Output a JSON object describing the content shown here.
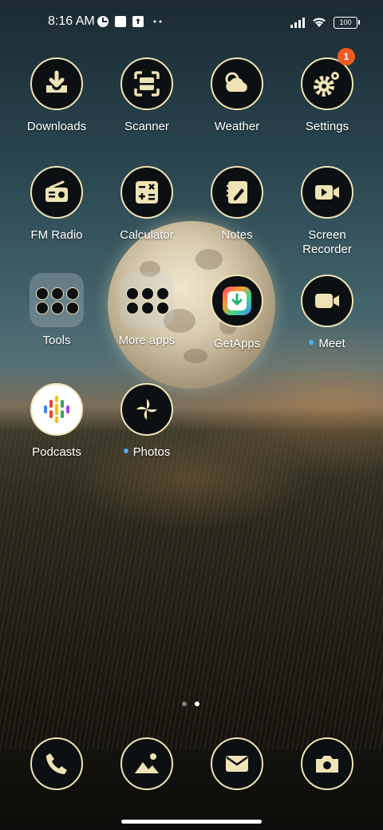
{
  "status_bar": {
    "time": "8:16 AM",
    "battery": "100"
  },
  "apps": {
    "downloads": {
      "label": "Downloads",
      "icon": "download-icon"
    },
    "scanner": {
      "label": "Scanner",
      "icon": "scanner-icon"
    },
    "weather": {
      "label": "Weather",
      "icon": "weather-icon"
    },
    "settings": {
      "label": "Settings",
      "icon": "gear-icon",
      "badge": "1"
    },
    "fm_radio": {
      "label": "FM Radio",
      "icon": "radio-icon"
    },
    "calculator": {
      "label": "Calculator",
      "icon": "calculator-icon"
    },
    "notes": {
      "label": "Notes",
      "icon": "notes-icon"
    },
    "screen_recorder": {
      "label_line1": "Screen",
      "label_line2": "Recorder",
      "icon": "video-camera-icon"
    },
    "tools": {
      "label": "Tools",
      "icon": "folder-icon"
    },
    "more_apps": {
      "label": "More apps",
      "icon": "folder-icon"
    },
    "getapps": {
      "label": "GetApps",
      "icon": "getapps-icon"
    },
    "meet": {
      "label": "Meet",
      "icon": "video-camera-icon"
    },
    "podcasts": {
      "label": "Podcasts",
      "icon": "podcasts-icon"
    },
    "photos": {
      "label": "Photos",
      "icon": "pinwheel-icon"
    }
  },
  "dock": {
    "phone": {
      "icon": "phone-icon"
    },
    "gallery": {
      "icon": "gallery-icon"
    },
    "email": {
      "icon": "envelope-icon"
    },
    "camera": {
      "icon": "camera-icon"
    }
  },
  "colors": {
    "icon_cream": "#efe3b5",
    "icon_bg": "#0d1012",
    "badge": "#f15a22",
    "new_dot": "#4ab0ff"
  }
}
